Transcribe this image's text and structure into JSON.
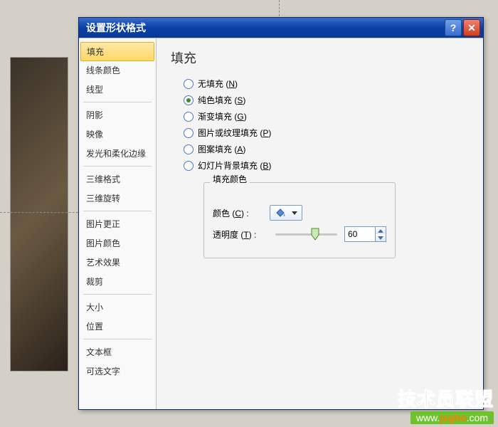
{
  "dialog": {
    "title": "设置形状格式"
  },
  "sidebar": {
    "items": [
      "填充",
      "线条颜色",
      "线型",
      "阴影",
      "映像",
      "发光和柔化边缘",
      "三维格式",
      "三维旋转",
      "图片更正",
      "图片颜色",
      "艺术效果",
      "裁剪",
      "大小",
      "位置",
      "文本框",
      "可选文字"
    ]
  },
  "content": {
    "heading": "填充",
    "radios": [
      {
        "label": "无填充",
        "accel": "N",
        "checked": false
      },
      {
        "label": "纯色填充",
        "accel": "S",
        "checked": true
      },
      {
        "label": "渐变填充",
        "accel": "G",
        "checked": false
      },
      {
        "label": "图片或纹理填充",
        "accel": "P",
        "checked": false
      },
      {
        "label": "图案填充",
        "accel": "A",
        "checked": false
      },
      {
        "label": "幻灯片背景填充",
        "accel": "B",
        "checked": false
      }
    ],
    "fillColor": {
      "legend": "填充颜色",
      "colorLabel": "颜色",
      "colorAccel": "C",
      "transparencyLabel": "透明度",
      "transparencyAccel": "T",
      "transparencyValue": "60"
    }
  },
  "watermark": {
    "line1": "技术员联盟",
    "url_pre": "www.",
    "url_mid": "jsgho",
    "url_post": ".com"
  }
}
